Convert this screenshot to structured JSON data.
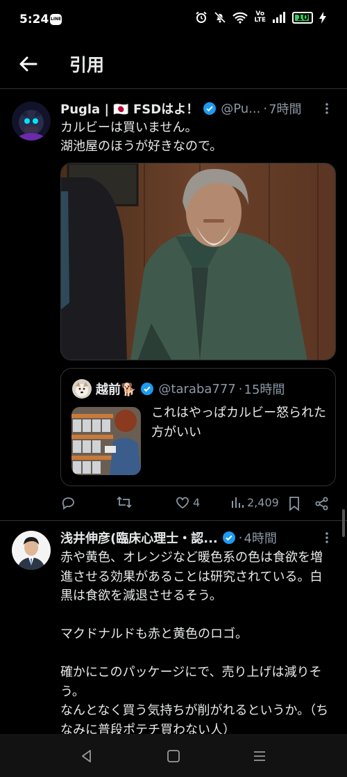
{
  "status": {
    "time": "5:24",
    "line_badge": "LINE",
    "volte": "Vo\nLTE",
    "battery": "10"
  },
  "header": {
    "title": "引用"
  },
  "tweet1": {
    "name": "Pugla | 🇯🇵 FSDはよ！",
    "handle": "@Pu...",
    "dot": "·",
    "time": "7時間",
    "text": "カルビーは買いません。\n湖池屋のほうが好きなので。",
    "quote": {
      "name": "越前🐕",
      "handle": "@taraba777",
      "dot": "·",
      "time": "15時間",
      "text": "これはやっぱカルビー怒られた方がいい"
    },
    "actions": {
      "reply_count": "",
      "retweet_count": "",
      "like_count": "4",
      "view_count": "2,409"
    }
  },
  "tweet2": {
    "name": "浅井伸彦(臨床心理士・認...",
    "handle": "",
    "dot": "·",
    "time": "4時間",
    "text": "赤や黄色、オレンジなど暖色系の色は食欲を増進させる効果があることは研究されている。白黒は食欲を減退させるそう。\n\nマクドナルドも赤と黄色のロゴ。\n\n確かにこのパッケージにで、売り上げは減りそう。\nなんとなく買う気持ちが削がれるというか。（ちなみに普段ポテチ買わない人）"
  },
  "colors": {
    "background": "#000000",
    "text_primary": "#e7e9ea",
    "text_secondary": "#8b98a5",
    "verified_blue": "#1d9bf0",
    "divider": "#2f3336"
  }
}
